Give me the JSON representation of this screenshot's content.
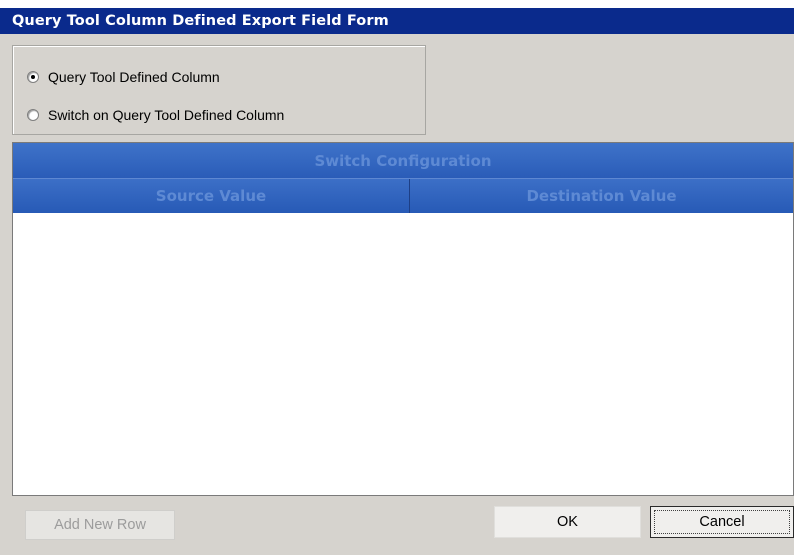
{
  "window": {
    "title": "Query Tool Column Defined Export Field Form"
  },
  "options": {
    "items": [
      {
        "label": "Query Tool Defined Column",
        "selected": true
      },
      {
        "label": "Switch on Query Tool Defined Column",
        "selected": false
      }
    ]
  },
  "grid": {
    "caption": "Switch Configuration",
    "columns": [
      "Source Value",
      "Destination Value"
    ],
    "rows": []
  },
  "buttons": {
    "add_new_row": "Add New Row",
    "ok": "OK",
    "cancel": "Cancel"
  },
  "colors": {
    "title_bar": "#0a2a8c",
    "grid_header": "#2a5cb8",
    "dialog_background": "#d6d3ce"
  }
}
